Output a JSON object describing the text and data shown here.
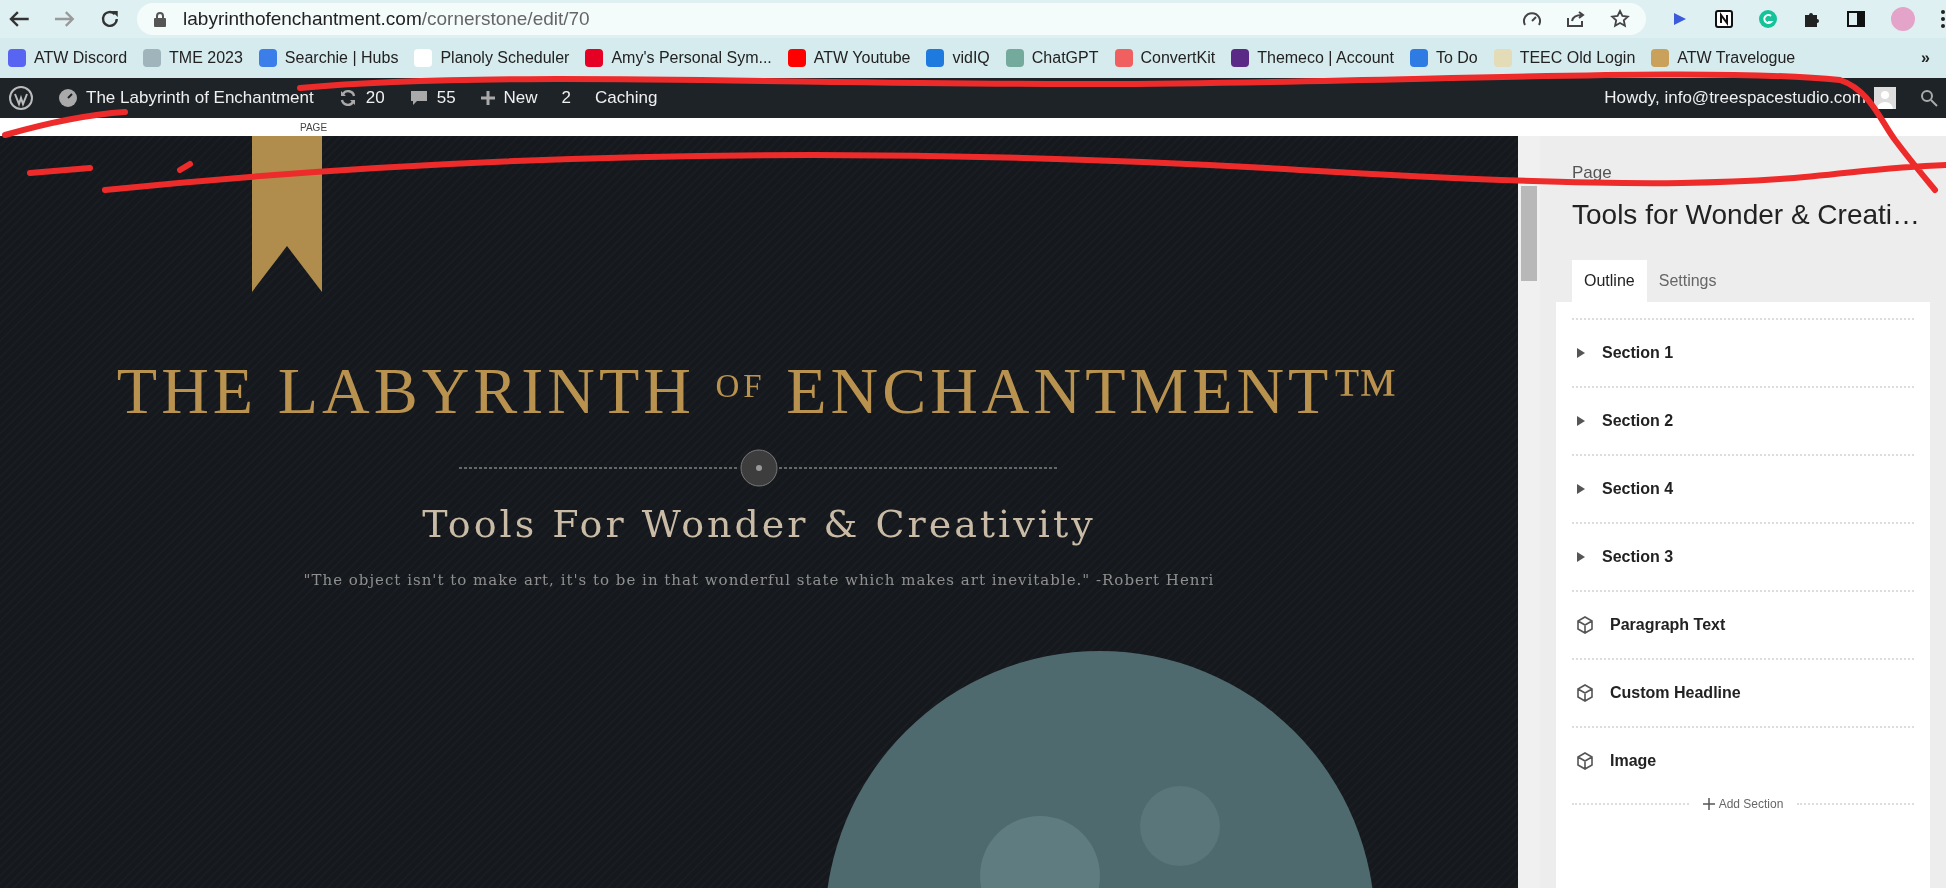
{
  "browser": {
    "url_host": "labyrinthofenchantment.com",
    "url_path": "/cornerstone/edit/70",
    "bookmarks": [
      {
        "label": "ATW Discord",
        "color": "#5865f2"
      },
      {
        "label": "TME 2023",
        "color": "#9fb4bb"
      },
      {
        "label": "Searchie | Hubs",
        "color": "#3b7de9"
      },
      {
        "label": "Planoly Scheduler",
        "color": "#ffffff"
      },
      {
        "label": "Amy's Personal Sym...",
        "color": "#e60023"
      },
      {
        "label": "ATW Youtube",
        "color": "#ff0000"
      },
      {
        "label": "vidIQ",
        "color": "#1f7ae0"
      },
      {
        "label": "ChatGPT",
        "color": "#74aa9c"
      },
      {
        "label": "ConvertKit",
        "color": "#f06060"
      },
      {
        "label": "Themeco | Account",
        "color": "#5b2a86"
      },
      {
        "label": "To Do",
        "color": "#2f7be4"
      },
      {
        "label": "TEEC Old Login",
        "color": "#e3dcb6"
      },
      {
        "label": "ATW Travelogue",
        "color": "#c9a15a"
      }
    ],
    "more": "»"
  },
  "admin_bar": {
    "site_title": "The Labyrinth of Enchantment",
    "updates": "20",
    "comments": "55",
    "new_label": "New",
    "count": "2",
    "caching": "Caching",
    "howdy": "Howdy, info@treespacestudio.com"
  },
  "sub_bar": {
    "label": "PAGE"
  },
  "preview": {
    "title": "THE LABYRINTH $^{OF}$ ENCHANTMENT™",
    "subtitle": "Tools For Wonder & Creativity",
    "quote": "\"The object isn't to make art, it's to be in that wonderful state which makes art inevitable.\" -Robert Henri"
  },
  "sidebar": {
    "kicker": "Page",
    "title": "Tools for Wonder & Creati…",
    "tabs": [
      {
        "label": "Outline",
        "selected": true
      },
      {
        "label": "Settings",
        "selected": false
      }
    ],
    "items": [
      {
        "kind": "section",
        "label": "Section 1"
      },
      {
        "kind": "section",
        "label": "Section 2"
      },
      {
        "kind": "section",
        "label": "Section 4"
      },
      {
        "kind": "section",
        "label": "Section 3"
      },
      {
        "kind": "element",
        "label": "Paragraph Text"
      },
      {
        "kind": "element",
        "label": "Custom Headline"
      },
      {
        "kind": "element",
        "label": "Image"
      }
    ],
    "add_label": "Add Section"
  }
}
